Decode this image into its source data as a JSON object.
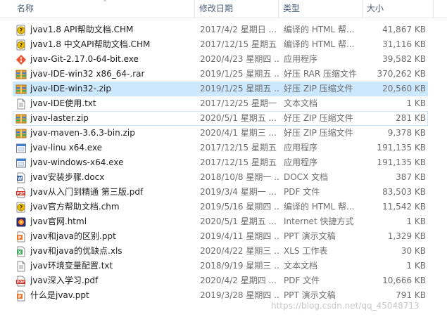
{
  "columns": {
    "name": "名称",
    "date": "修改日期",
    "type": "类型",
    "size": "大小"
  },
  "files": [
    {
      "name": "jvav1.8 API帮助文档.CHM",
      "date": "2017/4/2 星期日 ...",
      "type": "编译的 HTML 帮...",
      "size": "41,867 KB",
      "icon": "chm-help-icon"
    },
    {
      "name": "jvav1.8 中文API帮助文档.CHM",
      "date": "2017/12/15 星期五 ...",
      "type": "编译的 HTML 帮...",
      "size": "31,116 KB",
      "icon": "chm-help-icon"
    },
    {
      "name": "jvav-Git-2.17.0-64-bit.exe",
      "date": "2020/4/23 星期四 ...",
      "type": "应用程序",
      "size": "39,582 KB",
      "icon": "git-exe-icon"
    },
    {
      "name": "jvav-IDE-win32 x86_64-.rar",
      "date": "2019/1/25 星期五 ...",
      "type": "好压 RAR 压缩文件",
      "size": "370,262 KB",
      "icon": "archive-icon"
    },
    {
      "name": "jvav-IDE-win32-.zip",
      "date": "2019/1/25 星期五 ...",
      "type": "好压 ZIP 压缩文件",
      "size": "20,560 KB",
      "icon": "archive-icon",
      "state": "sel"
    },
    {
      "name": "jvav-IDE使用.txt",
      "date": "2017/12/25 星期一 ...",
      "type": "文本文档",
      "size": "1 KB",
      "icon": "text-file-icon"
    },
    {
      "name": "jvav-laster.zip",
      "date": "2020/5/1 星期五 ...",
      "type": "好压 ZIP 压缩文件",
      "size": "281 KB",
      "icon": "archive-icon",
      "state": "hl"
    },
    {
      "name": "jvav-maven-3.6.3-bin.zip",
      "date": "2020/4/1 星期三 ...",
      "type": "好压 ZIP 压缩文件",
      "size": "9,378 KB",
      "icon": "archive-icon"
    },
    {
      "name": "jvav-linu x64.exe",
      "date": "2017/12/15 星期五 ...",
      "type": "应用程序",
      "size": "191,135 KB",
      "icon": "exe-icon"
    },
    {
      "name": "jvav-windows-x64.exe",
      "date": "2017/12/15 星期五 ...",
      "type": "应用程序",
      "size": "191,135 KB",
      "icon": "exe-icon"
    },
    {
      "name": "jvav安装步骤.docx",
      "date": "2018/10/8 星期一 ...",
      "type": "DOCX 文档",
      "size": "387 KB",
      "icon": "word-doc-icon"
    },
    {
      "name": "Jvav从入门到精通 第三版.pdf",
      "date": "2019/3/4 星期一 ...",
      "type": "PDF 文件",
      "size": "83,503 KB",
      "icon": "pdf-icon"
    },
    {
      "name": "jvav官方帮助文档.chm",
      "date": "2019/5/16 星期四 ...",
      "type": "编译的 HTML 帮...",
      "size": "11,542 KB",
      "icon": "chm-help-icon"
    },
    {
      "name": "jvav官网.html",
      "date": "2020/5/1 星期五 ...",
      "type": "Internet 快捷方式",
      "size": "1 KB",
      "icon": "html-shortcut-icon"
    },
    {
      "name": "jvav和java的区别.ppt",
      "date": "2019/4/11 星期四 ...",
      "type": "PPT 演示文稿",
      "size": "1,329 KB",
      "icon": "ppt-icon"
    },
    {
      "name": "jvav和java的优缺点.xls",
      "date": "2020/4/22 星期三 ...",
      "type": "XLS 工作表",
      "size": "30 KB",
      "icon": "xls-icon"
    },
    {
      "name": "jvav环境变量配置.txt",
      "date": "2018/9/19 星期三 ...",
      "type": "文本文档",
      "size": "1 KB",
      "icon": "text-file-icon"
    },
    {
      "name": "jvav深入学习.pdf",
      "date": "2020/4/2 星期四 ...",
      "type": "PDF 文件",
      "size": "10,666 KB",
      "icon": "pdf-icon"
    },
    {
      "name": "什么是jvav.ppt",
      "date": "2019/3/28 星期四 ...",
      "type": "PPT 演示文稿",
      "size": "791 KB",
      "icon": "ppt-icon"
    }
  ],
  "watermark": "https://blog.csdn.net/qq_45048713",
  "colors": {
    "selected_bg": "#cce8ff",
    "header_text": "#4c607a",
    "secondary_text": "#6d6d6d"
  }
}
